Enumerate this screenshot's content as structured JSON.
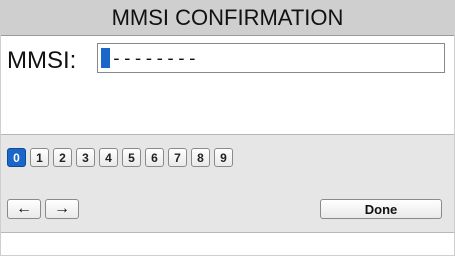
{
  "screen": {
    "title": "MMSI CONFIRMATION"
  },
  "mmsi": {
    "label": "MMSI:",
    "value_placeholder": "--------"
  },
  "keypad": {
    "digits": [
      "0",
      "1",
      "2",
      "3",
      "4",
      "5",
      "6",
      "7",
      "8",
      "9"
    ],
    "selected_digit": "0",
    "left_arrow": "←",
    "right_arrow": "→",
    "done_label": "Done"
  },
  "colors": {
    "selected": "#1a66c9",
    "title_bar": "#cfcfcf",
    "panel": "#e6e6e6"
  }
}
